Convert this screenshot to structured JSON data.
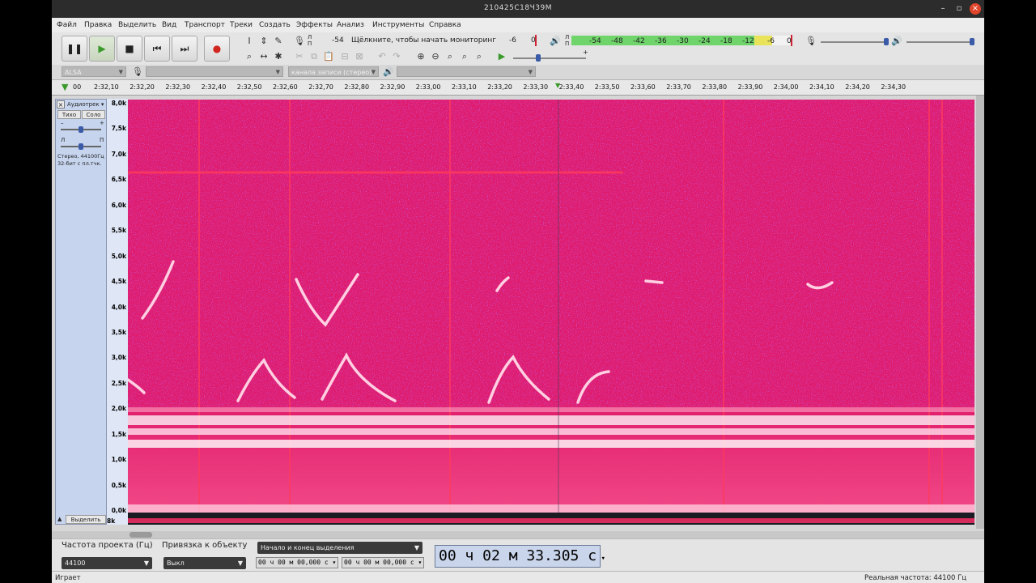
{
  "window": {
    "title": "210425C18Ч39М"
  },
  "menu": [
    "Файл",
    "Правка",
    "Выделить",
    "Вид",
    "Транспорт",
    "Треки",
    "Создать",
    "Эффекты",
    "Анализ",
    "Инструменты",
    "Справка"
  ],
  "toolbar": {
    "rec_meter_hint": "Щёлкните, чтобы начать мониторинг",
    "rec_meter_lr": [
      "Л",
      "П"
    ],
    "rec_meter_ticks": [
      "-54",
      "-6",
      "0"
    ],
    "play_meter_lr": [
      "Л",
      "П"
    ],
    "play_meter_ticks": [
      "-54",
      "-48",
      "-42",
      "-36",
      "-30",
      "-24",
      "-18",
      "-12",
      "-6",
      "0"
    ],
    "play_speed_plus": "+"
  },
  "devices": {
    "host": "ALSA",
    "rec_device": "",
    "rec_channels": "канала записи (стерео)",
    "play_device": ""
  },
  "ruler": {
    "ticks": [
      "2:32,10",
      "2:32,20",
      "2:32,30",
      "2:32,40",
      "2:32,50",
      "2:32,60",
      "2:32,70",
      "2:32,80",
      "2:32,90",
      "2:33,00",
      "2:33,10",
      "2:33,20",
      "2:33,30",
      "2:33,40",
      "2:33,50",
      "2:33,60",
      "2:33,70",
      "2:33,80",
      "2:33,90",
      "2:34,00",
      "2:34,10",
      "2:34,20",
      "2:34,30"
    ],
    "start_stub": "00"
  },
  "track": {
    "name": "Аудиотрек",
    "mute": "Тихо",
    "solo": "Соло",
    "gain_minus": "–",
    "gain_plus": "+",
    "pan_left": "Л",
    "pan_right": "П",
    "info_line1": "Стерео, 44100Гц",
    "info_line2": "32-бит с пл.тчк.",
    "select": "Выделить",
    "freq_labels": [
      "8,0k",
      "7,5k",
      "7,0k",
      "6,5k",
      "6,0k",
      "5,5k",
      "5,0k",
      "4,5k",
      "4,0k",
      "3,5k",
      "3,0k",
      "2,5k",
      "2,0k",
      "1,5k",
      "1,0k",
      "0,5k",
      "0,0k"
    ],
    "bottom_label": "8k"
  },
  "selection": {
    "rate_label": "Частота проекта (Гц)",
    "rate_value": "44100",
    "snap_label": "Привязка к объекту",
    "snap_value": "Выкл",
    "mode": "Начало и конец выделения",
    "start": "00 ч 00 м 00,000 с",
    "end": "00 ч 00 м 00,000 с",
    "position": "00 ч 02 м 33.305 с"
  },
  "status": {
    "left": "Играет",
    "right": "Реальная частота: 44100 Гц"
  },
  "colors": {
    "spectro_bg": "#e01a6a",
    "spectro_accent": "#8a1fc7",
    "spectro_hot": "#ffffff",
    "meter_green": "#6fd46a"
  }
}
